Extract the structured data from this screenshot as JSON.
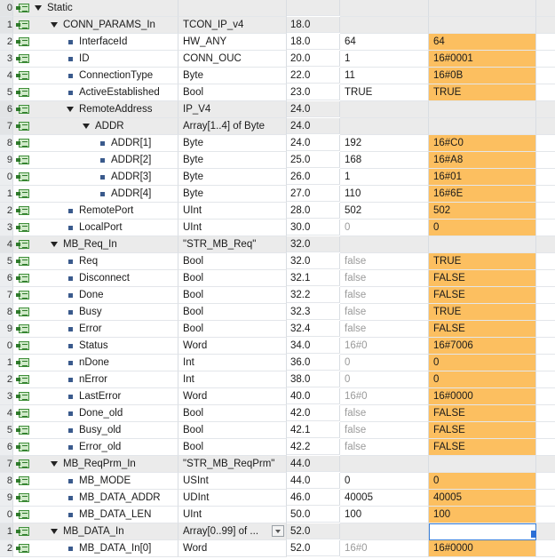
{
  "table": {
    "rows": [
      {
        "num": "0",
        "indent": 0,
        "expand": true,
        "name": "Static",
        "type": "",
        "offset": "",
        "start": "",
        "monitor": "",
        "gray": true,
        "mon_orange": false,
        "start_dim": false
      },
      {
        "num": "1",
        "indent": 1,
        "expand": true,
        "name": "CONN_PARAMS_In",
        "type": "TCON_IP_v4",
        "offset": "18.0",
        "start": "",
        "monitor": "",
        "gray": true,
        "mon_orange": false,
        "start_dim": false
      },
      {
        "num": "2",
        "indent": 2,
        "expand": false,
        "name": "InterfaceId",
        "type": "HW_ANY",
        "offset": "18.0",
        "start": "64",
        "monitor": "64",
        "gray": false,
        "mon_orange": true,
        "start_dim": false
      },
      {
        "num": "3",
        "indent": 2,
        "expand": false,
        "name": "ID",
        "type": "CONN_OUC",
        "offset": "20.0",
        "start": "1",
        "monitor": "16#0001",
        "gray": false,
        "mon_orange": true,
        "start_dim": false
      },
      {
        "num": "4",
        "indent": 2,
        "expand": false,
        "name": "ConnectionType",
        "type": "Byte",
        "offset": "22.0",
        "start": "11",
        "monitor": "16#0B",
        "gray": false,
        "mon_orange": true,
        "start_dim": false
      },
      {
        "num": "5",
        "indent": 2,
        "expand": false,
        "name": "ActiveEstablished",
        "type": "Bool",
        "offset": "23.0",
        "start": "TRUE",
        "monitor": "TRUE",
        "gray": false,
        "mon_orange": true,
        "start_dim": false
      },
      {
        "num": "6",
        "indent": 2,
        "expand": true,
        "name": "RemoteAddress",
        "type": "IP_V4",
        "offset": "24.0",
        "start": "",
        "monitor": "",
        "gray": true,
        "mon_orange": false,
        "start_dim": false
      },
      {
        "num": "7",
        "indent": 3,
        "expand": true,
        "name": "ADDR",
        "type": "Array[1..4] of Byte",
        "offset": "24.0",
        "start": "",
        "monitor": "",
        "gray": true,
        "mon_orange": false,
        "start_dim": false
      },
      {
        "num": "8",
        "indent": 4,
        "expand": false,
        "name": "ADDR[1]",
        "type": "Byte",
        "offset": "24.0",
        "start": "192",
        "monitor": "16#C0",
        "gray": false,
        "mon_orange": true,
        "start_dim": false
      },
      {
        "num": "9",
        "indent": 4,
        "expand": false,
        "name": "ADDR[2]",
        "type": "Byte",
        "offset": "25.0",
        "start": "168",
        "monitor": "16#A8",
        "gray": false,
        "mon_orange": true,
        "start_dim": false
      },
      {
        "num": "0",
        "indent": 4,
        "expand": false,
        "name": "ADDR[3]",
        "type": "Byte",
        "offset": "26.0",
        "start": "1",
        "monitor": "16#01",
        "gray": false,
        "mon_orange": true,
        "start_dim": false
      },
      {
        "num": "1",
        "indent": 4,
        "expand": false,
        "name": "ADDR[4]",
        "type": "Byte",
        "offset": "27.0",
        "start": "110",
        "monitor": "16#6E",
        "gray": false,
        "mon_orange": true,
        "start_dim": false
      },
      {
        "num": "2",
        "indent": 2,
        "expand": false,
        "name": "RemotePort",
        "type": "UInt",
        "offset": "28.0",
        "start": "502",
        "monitor": "502",
        "gray": false,
        "mon_orange": true,
        "start_dim": false
      },
      {
        "num": "3",
        "indent": 2,
        "expand": false,
        "name": "LocalPort",
        "type": "UInt",
        "offset": "30.0",
        "start": "0",
        "monitor": "0",
        "gray": false,
        "mon_orange": true,
        "start_dim": true
      },
      {
        "num": "4",
        "indent": 1,
        "expand": true,
        "name": "MB_Req_In",
        "type": "\"STR_MB_Req\"",
        "offset": "32.0",
        "start": "",
        "monitor": "",
        "gray": true,
        "mon_orange": false,
        "start_dim": false
      },
      {
        "num": "5",
        "indent": 2,
        "expand": false,
        "name": "Req",
        "type": "Bool",
        "offset": "32.0",
        "start": "false",
        "monitor": "TRUE",
        "gray": false,
        "mon_orange": true,
        "start_dim": true
      },
      {
        "num": "6",
        "indent": 2,
        "expand": false,
        "name": "Disconnect",
        "type": "Bool",
        "offset": "32.1",
        "start": "false",
        "monitor": "FALSE",
        "gray": false,
        "mon_orange": true,
        "start_dim": true
      },
      {
        "num": "7",
        "indent": 2,
        "expand": false,
        "name": "Done",
        "type": "Bool",
        "offset": "32.2",
        "start": "false",
        "monitor": "FALSE",
        "gray": false,
        "mon_orange": true,
        "start_dim": true
      },
      {
        "num": "8",
        "indent": 2,
        "expand": false,
        "name": "Busy",
        "type": "Bool",
        "offset": "32.3",
        "start": "false",
        "monitor": "TRUE",
        "gray": false,
        "mon_orange": true,
        "start_dim": true
      },
      {
        "num": "9",
        "indent": 2,
        "expand": false,
        "name": "Error",
        "type": "Bool",
        "offset": "32.4",
        "start": "false",
        "monitor": "FALSE",
        "gray": false,
        "mon_orange": true,
        "start_dim": true
      },
      {
        "num": "0",
        "indent": 2,
        "expand": false,
        "name": "Status",
        "type": "Word",
        "offset": "34.0",
        "start": "16#0",
        "monitor": "16#7006",
        "gray": false,
        "mon_orange": true,
        "start_dim": true
      },
      {
        "num": "1",
        "indent": 2,
        "expand": false,
        "name": "nDone",
        "type": "Int",
        "offset": "36.0",
        "start": "0",
        "monitor": "0",
        "gray": false,
        "mon_orange": true,
        "start_dim": true
      },
      {
        "num": "2",
        "indent": 2,
        "expand": false,
        "name": "nError",
        "type": "Int",
        "offset": "38.0",
        "start": "0",
        "monitor": "0",
        "gray": false,
        "mon_orange": true,
        "start_dim": true
      },
      {
        "num": "3",
        "indent": 2,
        "expand": false,
        "name": "LastError",
        "type": "Word",
        "offset": "40.0",
        "start": "16#0",
        "monitor": "16#0000",
        "gray": false,
        "mon_orange": true,
        "start_dim": true
      },
      {
        "num": "4",
        "indent": 2,
        "expand": false,
        "name": "Done_old",
        "type": "Bool",
        "offset": "42.0",
        "start": "false",
        "monitor": "FALSE",
        "gray": false,
        "mon_orange": true,
        "start_dim": true
      },
      {
        "num": "5",
        "indent": 2,
        "expand": false,
        "name": "Busy_old",
        "type": "Bool",
        "offset": "42.1",
        "start": "false",
        "monitor": "FALSE",
        "gray": false,
        "mon_orange": true,
        "start_dim": true
      },
      {
        "num": "6",
        "indent": 2,
        "expand": false,
        "name": "Error_old",
        "type": "Bool",
        "offset": "42.2",
        "start": "false",
        "monitor": "FALSE",
        "gray": false,
        "mon_orange": true,
        "start_dim": true
      },
      {
        "num": "7",
        "indent": 1,
        "expand": true,
        "name": "MB_ReqPrm_In",
        "type": "\"STR_MB_ReqPrm\"",
        "offset": "44.0",
        "start": "",
        "monitor": "",
        "gray": true,
        "mon_orange": false,
        "start_dim": false
      },
      {
        "num": "8",
        "indent": 2,
        "expand": false,
        "name": "MB_MODE",
        "type": "USInt",
        "offset": "44.0",
        "start": "0",
        "monitor": "0",
        "gray": false,
        "mon_orange": true,
        "start_dim": false
      },
      {
        "num": "9",
        "indent": 2,
        "expand": false,
        "name": "MB_DATA_ADDR",
        "type": "UDInt",
        "offset": "46.0",
        "start": "40005",
        "monitor": "40005",
        "gray": false,
        "mon_orange": true,
        "start_dim": false
      },
      {
        "num": "0",
        "indent": 2,
        "expand": false,
        "name": "MB_DATA_LEN",
        "type": "UInt",
        "offset": "50.0",
        "start": "100",
        "monitor": "100",
        "gray": false,
        "mon_orange": true,
        "start_dim": false
      },
      {
        "num": "1",
        "indent": 1,
        "expand": true,
        "name": "MB_DATA_In",
        "type": "Array[0..99] of ...",
        "offset": "52.0",
        "start": "",
        "monitor": "",
        "gray": true,
        "mon_orange": false,
        "start_dim": false,
        "dropdown": true,
        "selected": true
      },
      {
        "num": "2",
        "indent": 2,
        "expand": false,
        "name": "MB_DATA_In[0]",
        "type": "Word",
        "offset": "52.0",
        "start": "16#0",
        "monitor": "16#0000",
        "gray": false,
        "mon_orange": true,
        "start_dim": true
      }
    ]
  },
  "colors": {
    "monitor_highlight": "#fcbf60",
    "row_gray": "#ebebeb",
    "selection": "#3b7fd6"
  },
  "icons": {
    "row_icon": "db-tag-icon",
    "expand": "expand-triangle-icon",
    "leaf": "bullet-icon",
    "dropdown": "dropdown-arrow-icon"
  }
}
